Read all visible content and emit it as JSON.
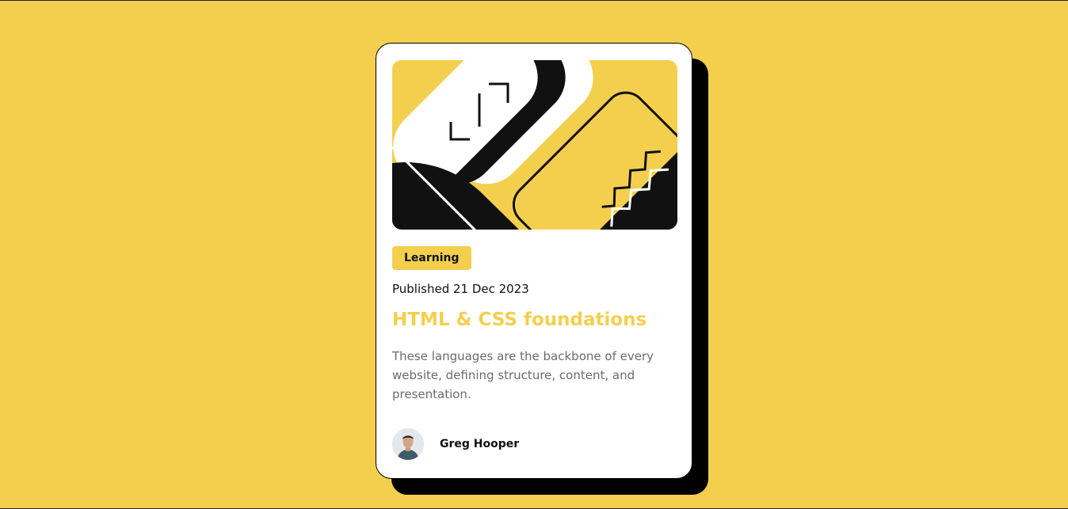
{
  "card": {
    "tag": "Learning",
    "published": "Published 21 Dec 2023",
    "title": "HTML & CSS foundations",
    "description": "These languages are the backbone of every website, defining structure, content, and presentation.",
    "author": {
      "name": "Greg Hooper",
      "avatar_icon": "person-avatar-icon"
    },
    "illustration_icon": "abstract-illustration-icon"
  },
  "colors": {
    "background": "#F4CF4E",
    "card": "#FFFFFF",
    "text": "#111111",
    "muted": "#6B6B6B",
    "accent": "#F4CF4E"
  }
}
